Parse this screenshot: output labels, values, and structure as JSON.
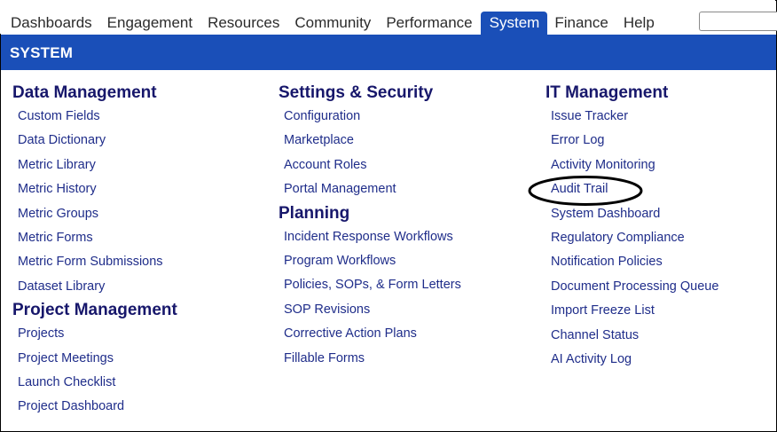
{
  "nav": {
    "tabs": [
      {
        "label": "Dashboards",
        "active": false
      },
      {
        "label": "Engagement",
        "active": false
      },
      {
        "label": "Resources",
        "active": false
      },
      {
        "label": "Community",
        "active": false
      },
      {
        "label": "Performance",
        "active": false
      },
      {
        "label": "System",
        "active": true
      },
      {
        "label": "Finance",
        "active": false
      },
      {
        "label": "Help",
        "active": false
      }
    ],
    "search": {
      "value": "",
      "placeholder": ""
    }
  },
  "band": {
    "title": "SYSTEM"
  },
  "columns": [
    {
      "groups": [
        {
          "title": "Data Management",
          "items": [
            "Custom Fields",
            "Data Dictionary",
            "Metric Library",
            "Metric History",
            "Metric Groups",
            "Metric Forms",
            "Metric Form Submissions",
            "Dataset Library"
          ]
        },
        {
          "title": "Project Management",
          "items": [
            "Projects",
            "Project Meetings",
            "Launch Checklist",
            "Project Dashboard"
          ]
        }
      ]
    },
    {
      "groups": [
        {
          "title": "Settings & Security",
          "items": [
            "Configuration",
            "Marketplace",
            "Account Roles",
            "Portal Management"
          ]
        },
        {
          "title": "Planning",
          "items": [
            "Incident Response Workflows",
            "Program Workflows",
            "Policies, SOPs, & Form Letters",
            "SOP Revisions",
            "Corrective Action Plans",
            "Fillable Forms"
          ]
        }
      ]
    },
    {
      "groups": [
        {
          "title": "IT Management",
          "items": [
            "Issue Tracker",
            "Error Log",
            "Activity Monitoring",
            "Audit Trail",
            "System Dashboard",
            "Regulatory Compliance",
            "Notification Policies",
            "Document Processing Queue",
            "Import Freeze List",
            "Channel Status",
            "AI Activity Log"
          ]
        }
      ]
    }
  ],
  "colors": {
    "accent": "#1a4fb8",
    "heading": "#17176b",
    "link": "#1f2d8a"
  }
}
